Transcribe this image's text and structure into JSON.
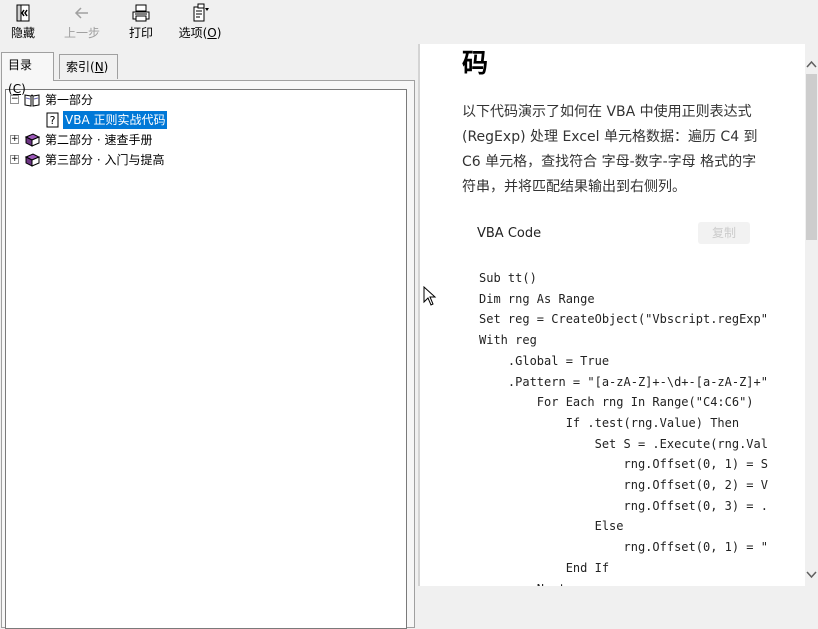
{
  "toolbar": {
    "hide": {
      "label": "隐藏",
      "icon": "hide-pane-icon"
    },
    "back": {
      "label": "上一步",
      "icon": "back-arrow-icon",
      "disabled": true
    },
    "print": {
      "label": "打印",
      "icon": "printer-icon"
    },
    "options": {
      "label_main": "选项(",
      "label_key": "O",
      "label_end": ")",
      "icon": "options-icon"
    }
  },
  "tabs": [
    {
      "main": "目录(",
      "key": "C",
      "end": ")",
      "active": true
    },
    {
      "main": "索引(",
      "key": "N",
      "end": ")",
      "active": false
    }
  ],
  "tree": {
    "items": [
      {
        "label": "第一部分",
        "expanded": true,
        "icon": "open-book-icon"
      },
      {
        "label": "VBA 正则实战代码",
        "selected": true,
        "icon": "help-page-icon"
      },
      {
        "label": "第二部分 · 速查手册",
        "expanded": false,
        "icon": "closed-book-icon"
      },
      {
        "label": "第三部分 · 入门与提高",
        "expanded": false,
        "icon": "closed-book-icon"
      }
    ]
  },
  "content": {
    "heading": "码",
    "paragraph": "以下代码演示了如何在 VBA 中使用正则表达式 (RegExp) 处理 Excel 单元格数据：遍历 C4 到 C6 单元格，查找符合  字母-数字-字母  格式的字符串，并将匹配结果输出到右侧列。",
    "code_block": {
      "title": "VBA Code",
      "copy_label": "复制",
      "lines": [
        "Sub tt()",
        "Dim rng As Range",
        "Set reg = CreateObject(\"Vbscript.regExp\"",
        "With reg",
        "    .Global = True",
        "    .Pattern = \"[a-zA-Z]+-\\d+-[a-zA-Z]+\"",
        "        For Each rng In Range(\"C4:C6\")",
        "            If .test(rng.Value) Then",
        "                Set S = .Execute(rng.Val",
        "                    rng.Offset(0, 1) = S",
        "                    rng.Offset(0, 2) = V",
        "                    rng.Offset(0, 3) = .",
        "                Else",
        "                    rng.Offset(0, 1) = \"",
        "            End If",
        "        Next"
      ]
    }
  },
  "colors": {
    "selection": "#0078d7",
    "window_bg": "#f0f0f0",
    "content_bg": "#ffffff"
  }
}
